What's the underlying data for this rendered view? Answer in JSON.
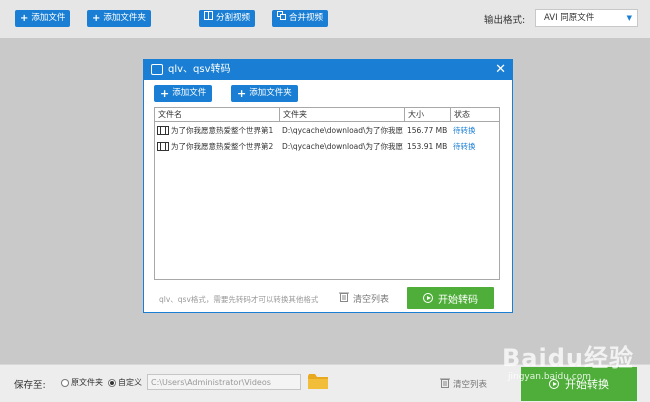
{
  "toolbar": {
    "add_file": "添加文件",
    "add_folder": "添加文件夹",
    "split_video": "分割视频",
    "merge_video": "合并视频",
    "output_format_label": "输出格式:",
    "output_format_value": "AVI  同原文件"
  },
  "dialog": {
    "title": "qlv、qsv转码",
    "add_file": "添加文件",
    "add_folder": "添加文件夹",
    "columns": [
      "文件名",
      "文件夹",
      "大小",
      "状态"
    ],
    "rows": [
      {
        "name": "为了你我愿意热爱整个世界第1",
        "folder": "D:\\qycache\\download\\为了你我愿",
        "size": "156.77 MB",
        "status": "待转换"
      },
      {
        "name": "为了你我愿意热爱整个世界第2",
        "folder": "D:\\qycache\\download\\为了你我愿",
        "size": "153.91 MB",
        "status": "待转换"
      }
    ],
    "hint": "qlv、qsv格式，需要先转码才可以转换其他格式",
    "clear_list": "清空列表",
    "start": "开始转码"
  },
  "bottom": {
    "save_label": "保存至:",
    "option_source": "原文件夹",
    "option_custom": "自定义",
    "path": "C:\\Users\\Administrator\\Videos",
    "clear_list": "清空列表",
    "start": "开始转换"
  },
  "watermark": {
    "text": "Baidu经验",
    "url": "jingyan.baidu.com"
  },
  "colors": {
    "accent": "#1a7fd4",
    "start_green": "#4fae3a",
    "background": "#c9c9c9"
  }
}
